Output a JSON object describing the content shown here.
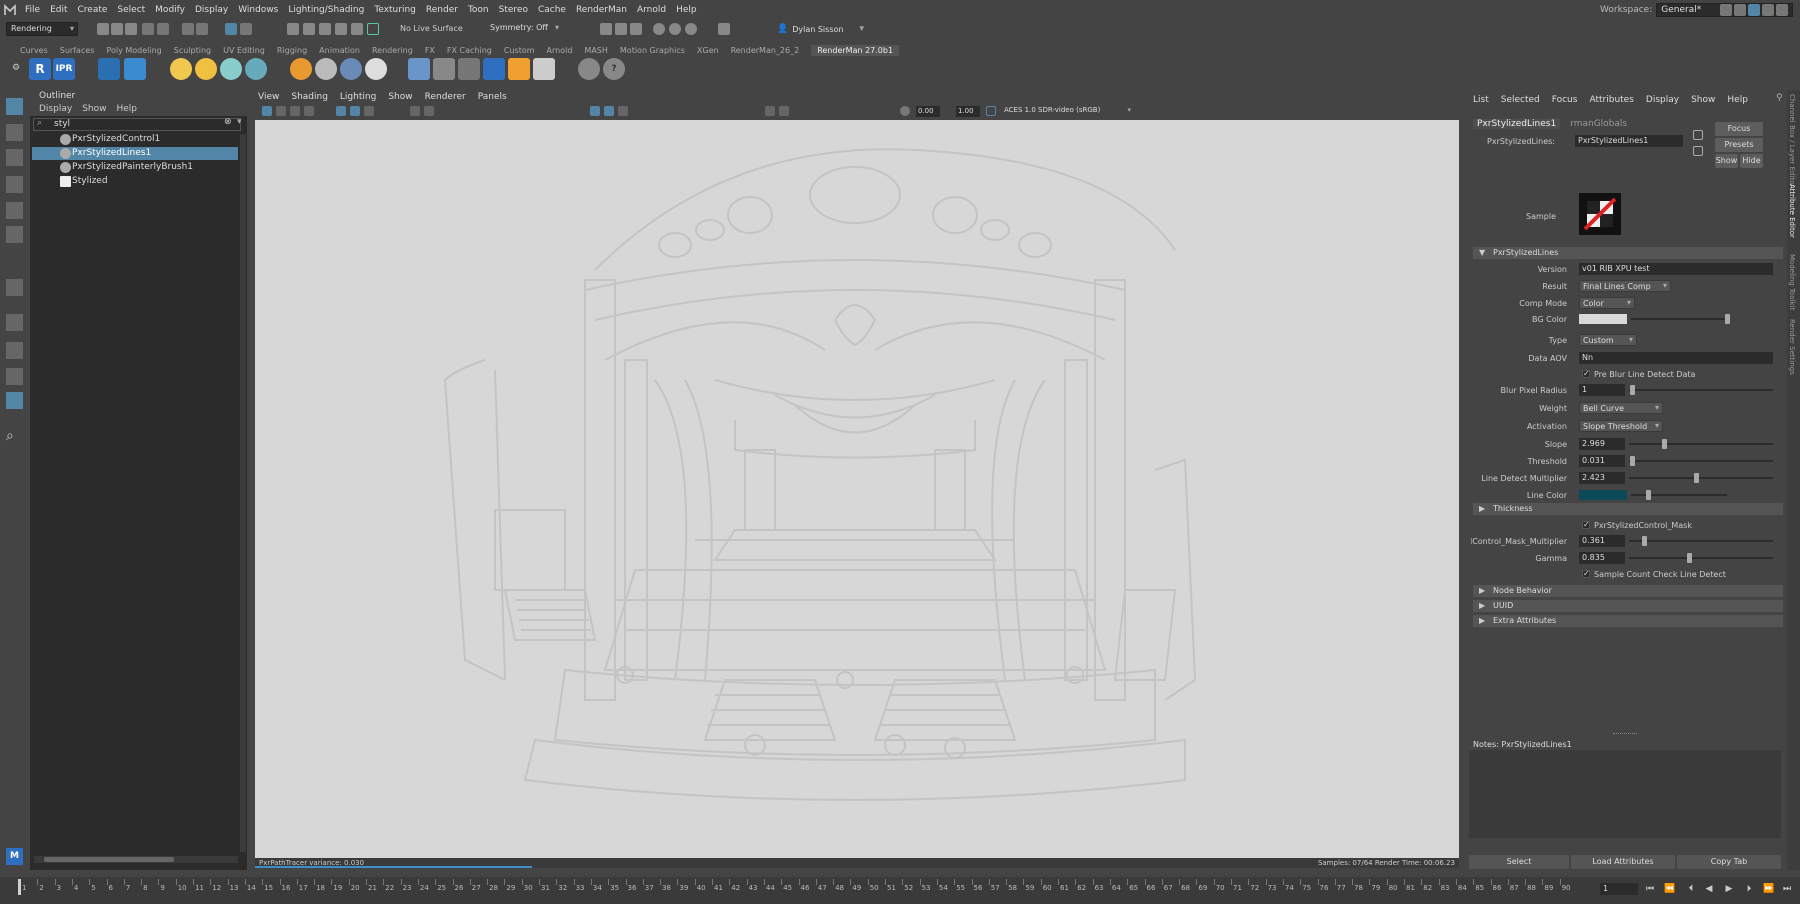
{
  "menubar": {
    "items": [
      "File",
      "Edit",
      "Create",
      "Select",
      "Modify",
      "Display",
      "Windows",
      "Lighting/Shading",
      "Texturing",
      "Render",
      "Toon",
      "Stereo",
      "Cache",
      "RenderMan",
      "Arnold",
      "Help"
    ],
    "workspace_label": "Workspace:",
    "workspace_value": "General*"
  },
  "statusline": {
    "mode": "Rendering",
    "live_surface": "No Live Surface",
    "symmetry": "Symmetry: Off",
    "user": "Dylan Sisson"
  },
  "shelf": {
    "tabs": [
      "Curves",
      "Surfaces",
      "Poly Modeling",
      "Sculpting",
      "UV Editing",
      "Rigging",
      "Animation",
      "Rendering",
      "FX",
      "FX Caching",
      "Custom",
      "Arnold",
      "MASH",
      "Motion Graphics",
      "XGen",
      "RenderMan_26_2",
      "RenderMan 27.0b1"
    ],
    "active_tab_index": 16,
    "ipr_label": "IPR",
    "r_label": "R"
  },
  "outliner": {
    "title": "Outliner",
    "menu": [
      "Display",
      "Show",
      "Help"
    ],
    "search": "styl",
    "items": [
      {
        "label": "PxrStylizedControl1",
        "selected": false
      },
      {
        "label": "PxrStylizedLines1",
        "selected": true
      },
      {
        "label": "PxrStylizedPainterlyBrush1",
        "selected": false
      },
      {
        "label": "Stylized",
        "selected": false
      }
    ]
  },
  "viewport": {
    "menu": [
      "View",
      "Shading",
      "Lighting",
      "Show",
      "Renderer",
      "Panels"
    ],
    "exposure": "0.00",
    "gamma": "1.00",
    "colorspace": "ACES 1.0 SDR-video (sRGB)",
    "status_left": "PxrPathTracer  variance: 0.030",
    "status_right": "Samples: 07/64   Render Time: 00:06.23",
    "progress": 0.23
  },
  "attr": {
    "menu": [
      "List",
      "Selected",
      "Focus",
      "Attributes",
      "Display",
      "Show",
      "Help"
    ],
    "tabs": [
      "PxrStylizedLines1",
      "rmanGlobals"
    ],
    "node_label": "PxrStylizedLines:",
    "node_value": "PxrStylizedLines1",
    "focus_btn": "Focus",
    "presets_btn": "Presets",
    "show_btn": "Show",
    "hide_btn": "Hide",
    "sample_label": "Sample",
    "section_main": "PxrStylizedLines",
    "version_label": "Version",
    "version_value": "v01 RIB XPU test",
    "result_label": "Result",
    "result_value": "Final Lines Comp",
    "comp_mode_label": "Comp Mode",
    "comp_mode_value": "Color",
    "bg_color_label": "BG Color",
    "bg_color": "#d9d9d9",
    "type_label": "Type",
    "type_value": "Custom",
    "data_aov_label": "Data AOV",
    "data_aov_value": "Nn",
    "pre_blur_label": "Pre Blur Line Detect Data",
    "blur_radius_label": "Blur Pixel Radius",
    "blur_radius_value": "1",
    "weight_label": "Weight",
    "weight_value": "Bell Curve",
    "activation_label": "Activation",
    "activation_value": "Slope Threshold",
    "slope_label": "Slope",
    "slope_value": "2.969",
    "threshold_label": "Threshold",
    "threshold_value": "0.031",
    "ld_mult_label": "Line Detect Multiplier",
    "ld_mult_value": "2.423",
    "line_color_label": "Line Color",
    "line_color": "#0c4a5a",
    "section_thickness": "Thickness",
    "mask_cb_label": "PxrStylizedControl_Mask",
    "mask_mult_label": "dControl_Mask_Multiplier",
    "mask_mult_value": "0.361",
    "gamma_label": "Gamma",
    "gamma_value": "0.835",
    "sample_count_label": "Sample Count Check Line Detect",
    "section_node_behavior": "Node Behavior",
    "section_uuid": "UUID",
    "section_extra": "Extra Attributes",
    "notes_label": "Notes:  PxrStylizedLines1",
    "select_btn": "Select",
    "load_btn": "Load Attributes",
    "copy_btn": "Copy Tab"
  },
  "side_tabs": [
    "Channel Box / Layer Editor",
    "Attribute Editor",
    "Modeling Toolkit",
    "Render Settings"
  ],
  "timeline": {
    "frames": [
      "1",
      "2",
      "3",
      "4",
      "5",
      "6",
      "7",
      "8",
      "9",
      "10",
      "11",
      "12",
      "13",
      "14",
      "15",
      "16",
      "17",
      "18",
      "19",
      "20",
      "21",
      "22",
      "23",
      "24",
      "25",
      "26",
      "27",
      "28",
      "29",
      "30",
      "31",
      "32",
      "33",
      "34",
      "35",
      "36",
      "37",
      "38",
      "39",
      "40",
      "41",
      "42",
      "43",
      "44",
      "45",
      "46",
      "47",
      "48",
      "49",
      "50",
      "51",
      "52",
      "53",
      "54",
      "55",
      "56",
      "57",
      "58",
      "59",
      "60",
      "61",
      "62",
      "63",
      "64",
      "65",
      "66",
      "67",
      "68",
      "69",
      "70",
      "71",
      "72",
      "73",
      "74",
      "75",
      "76",
      "77",
      "78",
      "79",
      "80",
      "81",
      "82",
      "83",
      "84",
      "85",
      "86",
      "87",
      "88",
      "89",
      "90"
    ],
    "current_frame": "1"
  }
}
